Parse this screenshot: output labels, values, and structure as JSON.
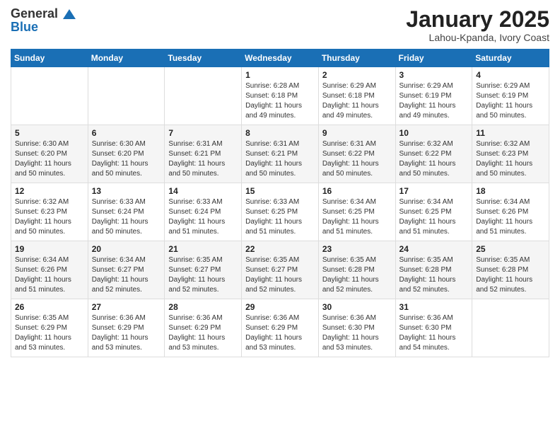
{
  "header": {
    "logo_general": "General",
    "logo_blue": "Blue",
    "title": "January 2025",
    "location": "Lahou-Kpanda, Ivory Coast"
  },
  "weekdays": [
    "Sunday",
    "Monday",
    "Tuesday",
    "Wednesday",
    "Thursday",
    "Friday",
    "Saturday"
  ],
  "weeks": [
    [
      {
        "day": "",
        "detail": ""
      },
      {
        "day": "",
        "detail": ""
      },
      {
        "day": "",
        "detail": ""
      },
      {
        "day": "1",
        "detail": "Sunrise: 6:28 AM\nSunset: 6:18 PM\nDaylight: 11 hours\nand 49 minutes."
      },
      {
        "day": "2",
        "detail": "Sunrise: 6:29 AM\nSunset: 6:18 PM\nDaylight: 11 hours\nand 49 minutes."
      },
      {
        "day": "3",
        "detail": "Sunrise: 6:29 AM\nSunset: 6:19 PM\nDaylight: 11 hours\nand 49 minutes."
      },
      {
        "day": "4",
        "detail": "Sunrise: 6:29 AM\nSunset: 6:19 PM\nDaylight: 11 hours\nand 50 minutes."
      }
    ],
    [
      {
        "day": "5",
        "detail": "Sunrise: 6:30 AM\nSunset: 6:20 PM\nDaylight: 11 hours\nand 50 minutes."
      },
      {
        "day": "6",
        "detail": "Sunrise: 6:30 AM\nSunset: 6:20 PM\nDaylight: 11 hours\nand 50 minutes."
      },
      {
        "day": "7",
        "detail": "Sunrise: 6:31 AM\nSunset: 6:21 PM\nDaylight: 11 hours\nand 50 minutes."
      },
      {
        "day": "8",
        "detail": "Sunrise: 6:31 AM\nSunset: 6:21 PM\nDaylight: 11 hours\nand 50 minutes."
      },
      {
        "day": "9",
        "detail": "Sunrise: 6:31 AM\nSunset: 6:22 PM\nDaylight: 11 hours\nand 50 minutes."
      },
      {
        "day": "10",
        "detail": "Sunrise: 6:32 AM\nSunset: 6:22 PM\nDaylight: 11 hours\nand 50 minutes."
      },
      {
        "day": "11",
        "detail": "Sunrise: 6:32 AM\nSunset: 6:23 PM\nDaylight: 11 hours\nand 50 minutes."
      }
    ],
    [
      {
        "day": "12",
        "detail": "Sunrise: 6:32 AM\nSunset: 6:23 PM\nDaylight: 11 hours\nand 50 minutes."
      },
      {
        "day": "13",
        "detail": "Sunrise: 6:33 AM\nSunset: 6:24 PM\nDaylight: 11 hours\nand 50 minutes."
      },
      {
        "day": "14",
        "detail": "Sunrise: 6:33 AM\nSunset: 6:24 PM\nDaylight: 11 hours\nand 51 minutes."
      },
      {
        "day": "15",
        "detail": "Sunrise: 6:33 AM\nSunset: 6:25 PM\nDaylight: 11 hours\nand 51 minutes."
      },
      {
        "day": "16",
        "detail": "Sunrise: 6:34 AM\nSunset: 6:25 PM\nDaylight: 11 hours\nand 51 minutes."
      },
      {
        "day": "17",
        "detail": "Sunrise: 6:34 AM\nSunset: 6:25 PM\nDaylight: 11 hours\nand 51 minutes."
      },
      {
        "day": "18",
        "detail": "Sunrise: 6:34 AM\nSunset: 6:26 PM\nDaylight: 11 hours\nand 51 minutes."
      }
    ],
    [
      {
        "day": "19",
        "detail": "Sunrise: 6:34 AM\nSunset: 6:26 PM\nDaylight: 11 hours\nand 51 minutes."
      },
      {
        "day": "20",
        "detail": "Sunrise: 6:34 AM\nSunset: 6:27 PM\nDaylight: 11 hours\nand 52 minutes."
      },
      {
        "day": "21",
        "detail": "Sunrise: 6:35 AM\nSunset: 6:27 PM\nDaylight: 11 hours\nand 52 minutes."
      },
      {
        "day": "22",
        "detail": "Sunrise: 6:35 AM\nSunset: 6:27 PM\nDaylight: 11 hours\nand 52 minutes."
      },
      {
        "day": "23",
        "detail": "Sunrise: 6:35 AM\nSunset: 6:28 PM\nDaylight: 11 hours\nand 52 minutes."
      },
      {
        "day": "24",
        "detail": "Sunrise: 6:35 AM\nSunset: 6:28 PM\nDaylight: 11 hours\nand 52 minutes."
      },
      {
        "day": "25",
        "detail": "Sunrise: 6:35 AM\nSunset: 6:28 PM\nDaylight: 11 hours\nand 52 minutes."
      }
    ],
    [
      {
        "day": "26",
        "detail": "Sunrise: 6:35 AM\nSunset: 6:29 PM\nDaylight: 11 hours\nand 53 minutes."
      },
      {
        "day": "27",
        "detail": "Sunrise: 6:36 AM\nSunset: 6:29 PM\nDaylight: 11 hours\nand 53 minutes."
      },
      {
        "day": "28",
        "detail": "Sunrise: 6:36 AM\nSunset: 6:29 PM\nDaylight: 11 hours\nand 53 minutes."
      },
      {
        "day": "29",
        "detail": "Sunrise: 6:36 AM\nSunset: 6:29 PM\nDaylight: 11 hours\nand 53 minutes."
      },
      {
        "day": "30",
        "detail": "Sunrise: 6:36 AM\nSunset: 6:30 PM\nDaylight: 11 hours\nand 53 minutes."
      },
      {
        "day": "31",
        "detail": "Sunrise: 6:36 AM\nSunset: 6:30 PM\nDaylight: 11 hours\nand 54 minutes."
      },
      {
        "day": "",
        "detail": ""
      }
    ]
  ]
}
